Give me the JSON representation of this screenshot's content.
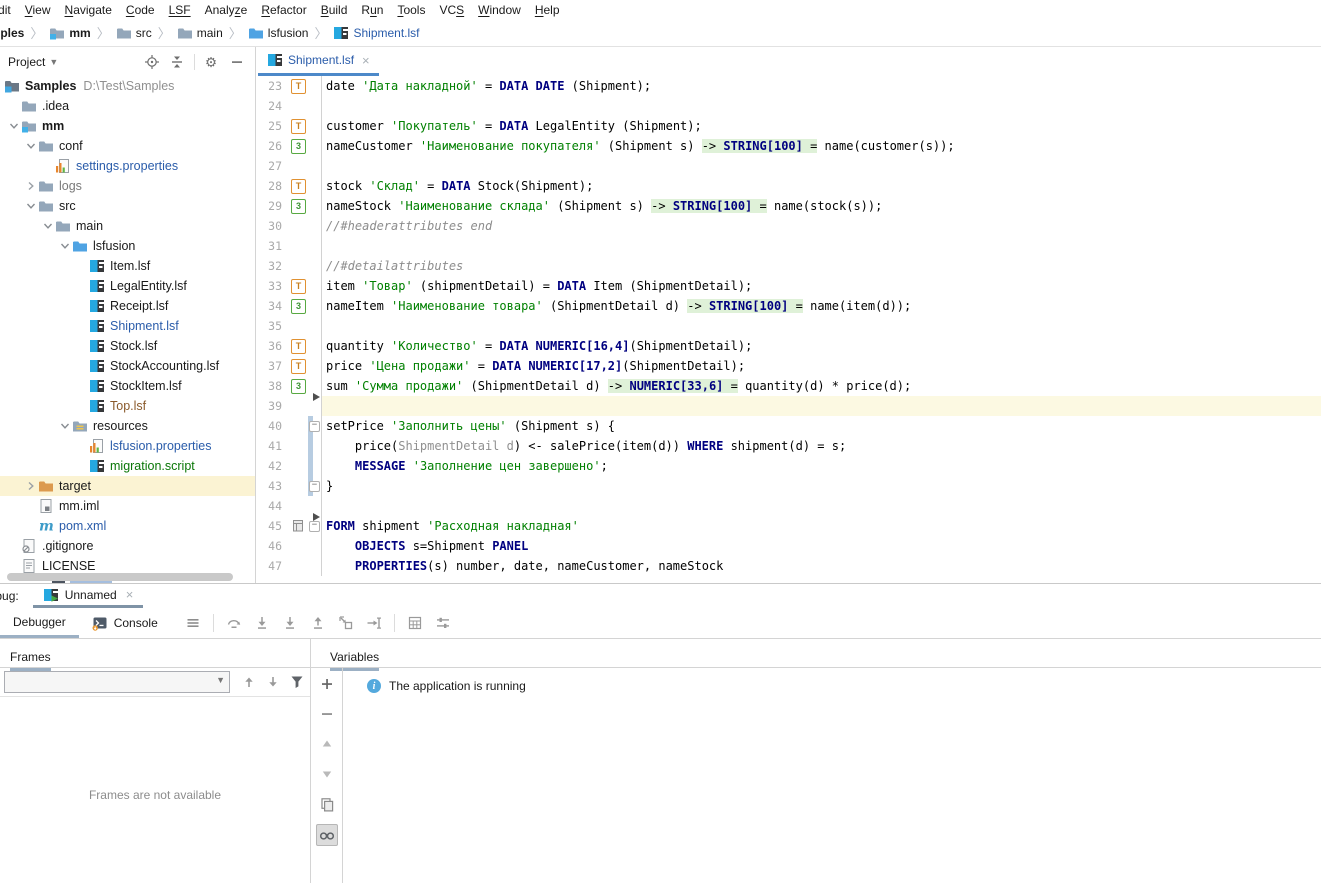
{
  "colors": {
    "accent_tab_underline": "#4d89c9",
    "tool_tab_underline": "#7f93a6",
    "keyword": "#000080",
    "string": "#008000",
    "comment": "#8c8c8c",
    "caret_row": "#fcf9e2",
    "type_hint_bg": "#dff1d8",
    "vcs_changed_bar": "#b7cce1",
    "vcs_modified_file": "#2a5caa",
    "vcs_added_file": "#0a7707",
    "vcs_unversioned_file": "#8a5a2b",
    "excluded_row_bg": "#fbf3d3"
  },
  "menu_bar": {
    "items": [
      {
        "label": "Edit",
        "mnemonic": 0
      },
      {
        "label": "View",
        "mnemonic": 0
      },
      {
        "label": "Navigate",
        "mnemonic": 0
      },
      {
        "label": "Code",
        "mnemonic": 0
      },
      {
        "label": "LSF",
        "mnemonic": "all"
      },
      {
        "label": "Analyze",
        "mnemonic": 5
      },
      {
        "label": "Refactor",
        "mnemonic": 0
      },
      {
        "label": "Build",
        "mnemonic": 0
      },
      {
        "label": "Run",
        "mnemonic": 1
      },
      {
        "label": "Tools",
        "mnemonic": 0
      },
      {
        "label": "VCS",
        "mnemonic": 2
      },
      {
        "label": "Window",
        "mnemonic": 0
      },
      {
        "label": "Help",
        "mnemonic": 0
      }
    ]
  },
  "breadcrumb_bar": {
    "items": [
      {
        "label": "Samples",
        "icon": null,
        "bold": true
      },
      {
        "label": "mm",
        "icon": "module",
        "bold": true
      },
      {
        "label": "src",
        "icon": "folder"
      },
      {
        "label": "main",
        "icon": "folder"
      },
      {
        "label": "lsfusion",
        "icon": "folder-src"
      },
      {
        "label": "Shipment.lsf",
        "icon": "lsf",
        "color": "#2a5caa"
      }
    ]
  },
  "project_panel": {
    "title": "Project",
    "toolbar_icons": [
      "locate-icon",
      "collapse-all-icon",
      "settings-icon",
      "hide-icon"
    ],
    "tree": [
      {
        "label": "Samples",
        "suffix": "D:\\Test\\Samples",
        "level": 0,
        "icon": "project",
        "bold": true
      },
      {
        "label": ".idea",
        "level": 1,
        "icon": "folder"
      },
      {
        "label": "mm",
        "level": 1,
        "icon": "module",
        "bold": true,
        "chevron": "down"
      },
      {
        "label": "conf",
        "level": 2,
        "icon": "folder",
        "chevron": "down"
      },
      {
        "label": "settings.properties",
        "level": 3,
        "icon": "properties",
        "color": "#2a5caa"
      },
      {
        "label": "logs",
        "level": 2,
        "icon": "folder",
        "chevron": "right",
        "color": "#7a7a7a"
      },
      {
        "label": "src",
        "level": 2,
        "icon": "folder",
        "chevron": "down"
      },
      {
        "label": "main",
        "level": 3,
        "icon": "folder",
        "chevron": "down"
      },
      {
        "label": "lsfusion",
        "level": 4,
        "icon": "folder-src",
        "chevron": "down"
      },
      {
        "label": "Item.lsf",
        "level": 5,
        "icon": "lsf"
      },
      {
        "label": "LegalEntity.lsf",
        "level": 5,
        "icon": "lsf"
      },
      {
        "label": "Receipt.lsf",
        "level": 5,
        "icon": "lsf"
      },
      {
        "label": "Shipment.lsf",
        "level": 5,
        "icon": "lsf",
        "color": "#2a5caa"
      },
      {
        "label": "Stock.lsf",
        "level": 5,
        "icon": "lsf"
      },
      {
        "label": "StockAccounting.lsf",
        "level": 5,
        "icon": "lsf"
      },
      {
        "label": "StockItem.lsf",
        "level": 5,
        "icon": "lsf"
      },
      {
        "label": "Top.lsf",
        "level": 5,
        "icon": "lsf",
        "color": "#8a5a2b"
      },
      {
        "label": "resources",
        "level": 4,
        "icon": "folder-res",
        "chevron": "down"
      },
      {
        "label": "lsfusion.properties",
        "level": 5,
        "icon": "properties",
        "color": "#2a5caa"
      },
      {
        "label": "migration.script",
        "level": 5,
        "icon": "lsf",
        "color": "#0a7707"
      },
      {
        "label": "target",
        "level": 2,
        "icon": "folder-excluded",
        "chevron": "right",
        "bg": "#fbf3d3"
      },
      {
        "label": "mm.iml",
        "level": 2,
        "icon": "iml"
      },
      {
        "label": "pom.xml",
        "level": 2,
        "icon": "maven",
        "color": "#2a5caa"
      },
      {
        "label": ".gitignore",
        "level": 1,
        "icon": "gitignore"
      },
      {
        "label": "LICENSE",
        "level": 1,
        "icon": "text"
      }
    ]
  },
  "editor": {
    "active_tab": {
      "label": "Shipment.lsf",
      "color": "#2a5caa"
    },
    "lines": [
      {
        "n": 23,
        "g": "T",
        "seg": [
          [
            "date ",
            "p"
          ],
          [
            "'Дата накладной'",
            "s"
          ],
          [
            " = ",
            "p"
          ],
          [
            "DATA DATE",
            "k"
          ],
          [
            " (Shipment);",
            "p"
          ]
        ]
      },
      {
        "n": 24,
        "seg": []
      },
      {
        "n": 25,
        "g": "T",
        "seg": [
          [
            "customer ",
            "p"
          ],
          [
            "'Покупатель'",
            "s"
          ],
          [
            " = ",
            "p"
          ],
          [
            "DATA",
            "k"
          ],
          [
            " LegalEntity (Shipment);",
            "p"
          ]
        ]
      },
      {
        "n": 26,
        "g": "3",
        "seg": [
          [
            "nameCustomer ",
            "p"
          ],
          [
            "'Наименование покупателя'",
            "s"
          ],
          [
            " (Shipment s) ",
            "p"
          ],
          [
            "-> ",
            "p",
            1
          ],
          [
            "STRING[100]",
            "k",
            1
          ],
          [
            " =",
            "p",
            1
          ],
          [
            " name(customer(s));",
            "p"
          ]
        ]
      },
      {
        "n": 27,
        "seg": []
      },
      {
        "n": 28,
        "g": "T",
        "seg": [
          [
            "stock ",
            "p"
          ],
          [
            "'Склад'",
            "s"
          ],
          [
            " = ",
            "p"
          ],
          [
            "DATA",
            "k"
          ],
          [
            " Stock(Shipment);",
            "p"
          ]
        ]
      },
      {
        "n": 29,
        "g": "3",
        "seg": [
          [
            "nameStock ",
            "p"
          ],
          [
            "'Наименование склада'",
            "s"
          ],
          [
            " (Shipment s) ",
            "p"
          ],
          [
            "-> ",
            "p",
            1
          ],
          [
            "STRING[100]",
            "k",
            1
          ],
          [
            " =",
            "p",
            1
          ],
          [
            " name(stock(s));",
            "p"
          ]
        ]
      },
      {
        "n": 30,
        "seg": [
          [
            "//#headerattributes end",
            "c"
          ]
        ]
      },
      {
        "n": 31,
        "seg": []
      },
      {
        "n": 32,
        "seg": [
          [
            "//#detailattributes",
            "c"
          ]
        ]
      },
      {
        "n": 33,
        "g": "T",
        "seg": [
          [
            "item ",
            "p"
          ],
          [
            "'Товар'",
            "s"
          ],
          [
            " (shipmentDetail) = ",
            "p"
          ],
          [
            "DATA",
            "k"
          ],
          [
            " Item (ShipmentDetail);",
            "p"
          ]
        ]
      },
      {
        "n": 34,
        "g": "3",
        "seg": [
          [
            "nameItem ",
            "p"
          ],
          [
            "'Наименование товара'",
            "s"
          ],
          [
            " (ShipmentDetail d) ",
            "p"
          ],
          [
            "-> ",
            "p",
            1
          ],
          [
            "STRING[100]",
            "k",
            1
          ],
          [
            " =",
            "p",
            1
          ],
          [
            " name(item(d));",
            "p"
          ]
        ]
      },
      {
        "n": 35,
        "seg": []
      },
      {
        "n": 36,
        "g": "T",
        "seg": [
          [
            "quantity ",
            "p"
          ],
          [
            "'Количество'",
            "s"
          ],
          [
            " = ",
            "p"
          ],
          [
            "DATA NUMERIC[16,4]",
            "k"
          ],
          [
            "(ShipmentDetail);",
            "p"
          ]
        ]
      },
      {
        "n": 37,
        "g": "T",
        "seg": [
          [
            "price ",
            "p"
          ],
          [
            "'Цена продажи'",
            "s"
          ],
          [
            " = ",
            "p"
          ],
          [
            "DATA NUMERIC[17,2]",
            "k"
          ],
          [
            "(ShipmentDetail);",
            "p"
          ]
        ]
      },
      {
        "n": 38,
        "g": "3",
        "mark": true,
        "seg": [
          [
            "sum ",
            "p"
          ],
          [
            "'Сумма продажи'",
            "s"
          ],
          [
            " (ShipmentDetail d) ",
            "p"
          ],
          [
            "-> ",
            "p",
            1
          ],
          [
            "NUMERIC[33,6]",
            "k",
            1
          ],
          [
            " =",
            "p",
            1
          ],
          [
            " quantity(d) * price(d);",
            "p"
          ]
        ]
      },
      {
        "n": 39,
        "cur": true,
        "seg": []
      },
      {
        "n": 40,
        "fold": "start",
        "chg": true,
        "seg": [
          [
            "setPrice ",
            "p"
          ],
          [
            "'Заполнить цены'",
            "s"
          ],
          [
            " (Shipment s) {",
            "p"
          ]
        ]
      },
      {
        "n": 41,
        "chg": true,
        "seg": [
          [
            "    price(",
            "p"
          ],
          [
            "ShipmentDetail d",
            "g"
          ],
          [
            ") <- salePrice(item(d)) ",
            "p"
          ],
          [
            "WHERE",
            "k"
          ],
          [
            " shipment(d) = s;",
            "p"
          ]
        ]
      },
      {
        "n": 42,
        "chg": true,
        "seg": [
          [
            "    ",
            "p"
          ],
          [
            "MESSAGE",
            "k"
          ],
          [
            " ",
            "p"
          ],
          [
            "'Заполнение цен завершено'",
            "s"
          ],
          [
            ";",
            "p"
          ]
        ]
      },
      {
        "n": 43,
        "fold": "end",
        "chg": true,
        "seg": [
          [
            "}",
            "p"
          ]
        ]
      },
      {
        "n": 44,
        "mark": true,
        "seg": []
      },
      {
        "n": 45,
        "g": "form",
        "fold": "start",
        "seg": [
          [
            "FORM",
            "k"
          ],
          [
            " shipment ",
            "p"
          ],
          [
            "'Расходная накладная'",
            "s"
          ]
        ]
      },
      {
        "n": 46,
        "seg": [
          [
            "    ",
            "p"
          ],
          [
            "OBJECTS",
            "k"
          ],
          [
            " s=Shipment ",
            "p"
          ],
          [
            "PANEL",
            "k"
          ]
        ]
      },
      {
        "n": 47,
        "seg": [
          [
            "    ",
            "p"
          ],
          [
            "PROPERTIES",
            "k"
          ],
          [
            "(s) number, date, nameCustomer, nameStock",
            "p"
          ]
        ]
      }
    ]
  },
  "debug_panel": {
    "window_label": "Debug:",
    "session_tab": "Unnamed",
    "view_tabs": [
      {
        "label": "Debugger",
        "selected": true
      },
      {
        "label": "Console",
        "icon": "console-icon"
      }
    ],
    "toolbar": [
      "more-icon",
      "sep",
      "step-over-icon",
      "step-into-icon",
      "force-step-into-icon",
      "step-out-icon",
      "drop-frame-icon",
      "run-to-cursor-icon",
      "sep",
      "evaluate-expression-icon",
      "layout-settings-icon"
    ],
    "frames": {
      "title": "Frames",
      "combo_value": "",
      "toolbar": [
        "up-icon",
        "down-icon",
        "filter-icon"
      ],
      "empty_text": "Frames are not available"
    },
    "variables": {
      "title": "Variables",
      "toolbar": [
        "add-icon",
        "remove-icon",
        "move-up-icon",
        "move-down-icon",
        "duplicate-icon",
        "watches-icon"
      ],
      "status_text": "The application is running"
    }
  }
}
